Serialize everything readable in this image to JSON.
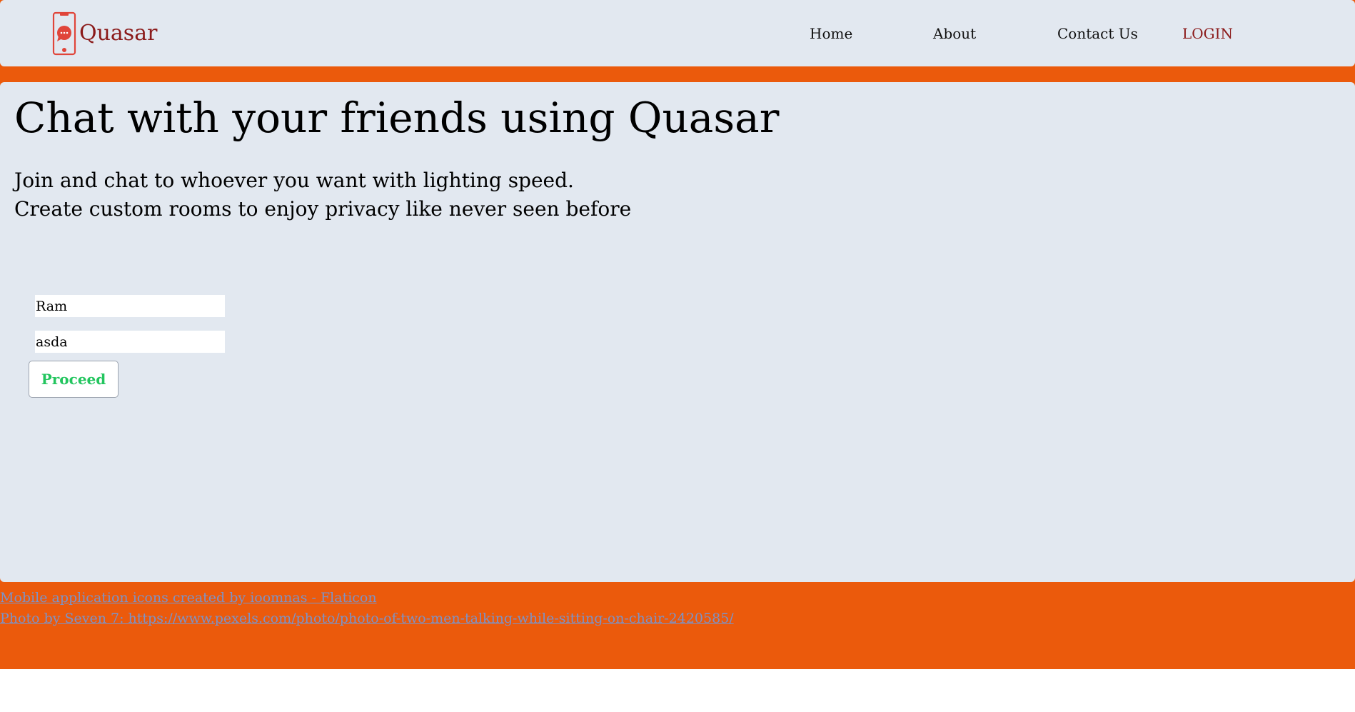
{
  "brand": {
    "name": "Quasar",
    "icon": "mobile-chat-icon",
    "color": "#8b1a1a",
    "icon_color": "#e0453a"
  },
  "nav": {
    "items": [
      {
        "label": "Home"
      },
      {
        "label": "About"
      },
      {
        "label": "Contact Us"
      },
      {
        "label": "LOGIN"
      }
    ]
  },
  "hero": {
    "title": "Chat with your friends using Quasar",
    "lines": [
      "Join and chat to whoever you want with lighting speed.",
      "Create custom rooms to enjoy privacy like never seen before"
    ]
  },
  "form": {
    "name_value": "Ram",
    "room_value": "asda",
    "proceed_label": "Proceed"
  },
  "credits": [
    {
      "text": "Mobile application icons created by ioomnas - Flaticon"
    },
    {
      "text": "Photo by Seven 7: https://www.pexels.com/photo/photo-of-two-men-talking-while-sitting-on-chair-2420585/"
    }
  ],
  "colors": {
    "accent_orange": "#eb5a0c",
    "panel_bg": "#e2e8f0",
    "proceed_text": "#22c55e",
    "link": "#7c93c8"
  }
}
